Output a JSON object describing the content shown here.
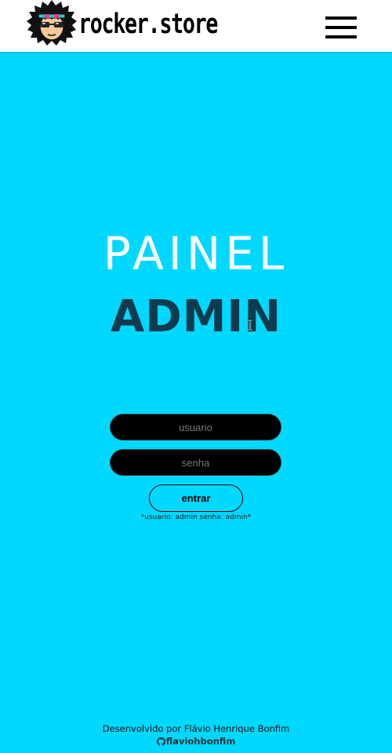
{
  "header": {
    "brand": "rocker.store",
    "logo_icon": "rocker-avatar-icon",
    "menu_icon": "hamburger-menu-icon",
    "background": "#ffffff"
  },
  "main": {
    "title_line1": "PAINEL",
    "title_line2": "ADMIN",
    "background": "#00d8ff"
  },
  "form": {
    "username": {
      "placeholder": "usuario",
      "value": ""
    },
    "password": {
      "placeholder": "senha",
      "value": ""
    },
    "submit_label": "entrar",
    "hint": "*usuario: admin senha: admin*"
  },
  "footer": {
    "credit": "Desenvolvido por Flávio Henrique Bonfim",
    "github_handle": "flaviohbonfim",
    "github_icon": "github-icon"
  },
  "colors": {
    "accent": "#00d8ff",
    "title_dark": "#0f3b4e",
    "input_bg": "#000000"
  }
}
